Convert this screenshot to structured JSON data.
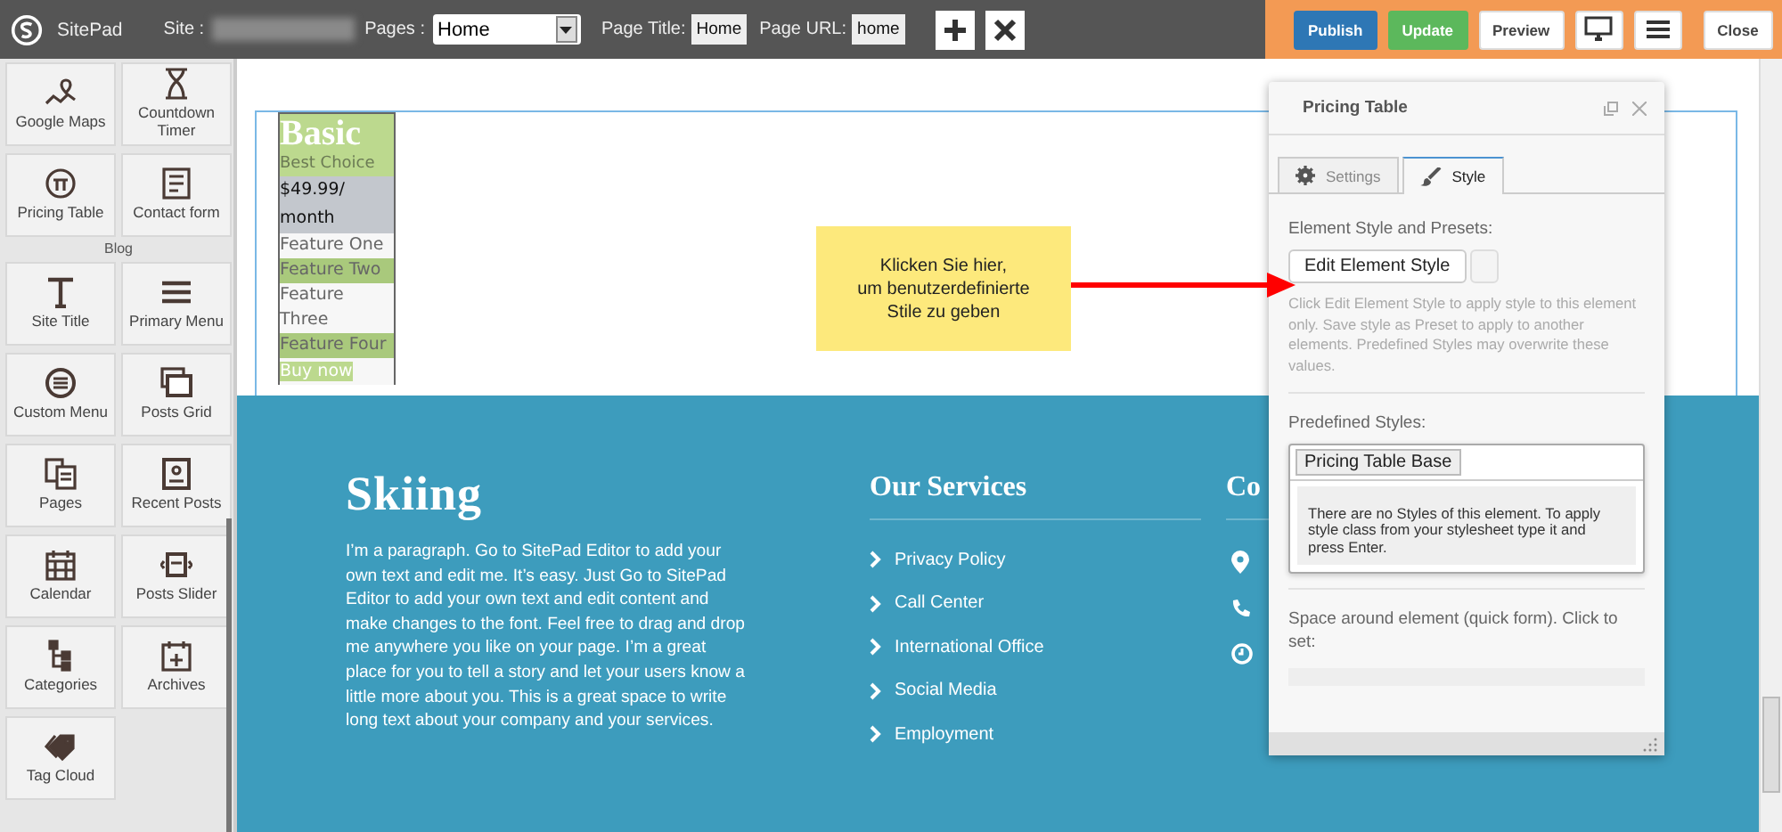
{
  "topbar": {
    "logo_text": "SitePad",
    "site_label": "Site :",
    "pages_label": "Pages :",
    "pages_value": "Home",
    "page_title_label": "Page Title:",
    "page_title_value": "Home",
    "page_url_label": "Page URL:",
    "page_url_value": "home",
    "actions": [
      {
        "kind": "primary",
        "label": "Publish"
      },
      {
        "kind": "success",
        "label": "Update"
      },
      {
        "kind": "plain",
        "label": "Preview"
      },
      {
        "kind": "monitor"
      },
      {
        "kind": "menu"
      },
      {
        "kind": "plain",
        "label": "Close"
      }
    ]
  },
  "sidebar": {
    "groups": [
      {
        "items": [
          {
            "kind": "map",
            "label": "Google Maps"
          },
          {
            "kind": "hourglass",
            "label": "Countdown Timer"
          },
          {
            "kind": "price",
            "label": "Pricing Table"
          },
          {
            "kind": "form",
            "label": "Contact form"
          }
        ]
      },
      {
        "heading": "Blog",
        "items": [
          {
            "kind": "title",
            "label": "Site Title"
          },
          {
            "kind": "menu",
            "label": "Primary Menu"
          },
          {
            "kind": "circlemenu",
            "label": "Custom Menu"
          },
          {
            "kind": "grid",
            "label": "Posts Grid"
          },
          {
            "kind": "pages",
            "label": "Pages"
          },
          {
            "kind": "posts",
            "label": "Recent Posts"
          },
          {
            "kind": "calendar",
            "label": "Calendar"
          },
          {
            "kind": "slider",
            "label": "Posts Slider"
          },
          {
            "kind": "tree",
            "label": "Categories"
          },
          {
            "kind": "archive",
            "label": "Archives"
          },
          {
            "kind": "tag",
            "label": "Tag Cloud"
          }
        ]
      }
    ]
  },
  "pricing_table": {
    "title": "Basic",
    "subtitle": "Best Choice",
    "price": "$49.99/ month",
    "features": [
      {
        "text": "Feature One",
        "highlighted": false
      },
      {
        "text": "Feature Two",
        "highlighted": true
      },
      {
        "text": "Feature Three",
        "highlighted": false
      },
      {
        "text": "Feature Four",
        "highlighted": true
      }
    ],
    "button": "Buy now"
  },
  "callout": {
    "text": "Klicken Sie hier,\num benutzerdefinierte\nStile zu geben"
  },
  "footer": {
    "about": {
      "title": "Skiing",
      "text": "I’m a paragraph. Go to SitePad Editor to add your own text and edit me. It’s easy. Just Go to SitePad Editor to add your own text and edit content and make changes to the font. Feel free to drag and drop me anywhere you like on your page. I’m a great place for you to tell a story and let your users know a little more about you. This is a great space to write long text about your company and your services."
    },
    "services": {
      "title": "Our Services",
      "items": [
        "Privacy Policy",
        "Call Center",
        "International Office",
        "Social Media",
        "Employment"
      ]
    },
    "contact": {
      "title": "Co",
      "items": [
        {
          "kind": "pin"
        },
        {
          "kind": "phone"
        },
        {
          "kind": "clock"
        }
      ]
    }
  },
  "panel": {
    "title": "Pricing Table",
    "tabs": [
      {
        "kind": "gear",
        "label": "Settings",
        "selected": false
      },
      {
        "kind": "brush",
        "label": "Style",
        "selected": true
      }
    ],
    "presets_label": "Element Style and Presets:",
    "edit_button": "Edit Element Style",
    "help": "Click Edit Element Style to apply style to this element only. Save style as Preset to apply to another elements. Predefined Styles may overwrite these values.",
    "predefined_label": "Predefined Styles:",
    "predefined_tag": "Pricing Table Base",
    "dropdown_message": "There are no Styles of this element. To apply style class from your stylesheet type it and press Enter.",
    "space_label": "Space around element (quick form). Click to set:"
  }
}
